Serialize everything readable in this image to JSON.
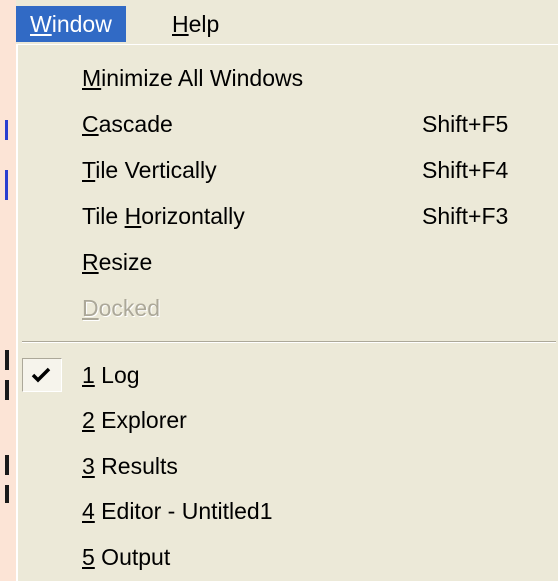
{
  "menubar": {
    "window": {
      "label_u": "W",
      "label_rest": "indow",
      "active": true
    },
    "help": {
      "label_u": "H",
      "label_rest": "elp"
    }
  },
  "menu": {
    "items": [
      {
        "u": "M",
        "rest": "inimize All Windows",
        "shortcut": "",
        "enabled": true
      },
      {
        "u": "C",
        "rest": "ascade",
        "shortcut": "Shift+F5",
        "enabled": true
      },
      {
        "u": "T",
        "rest": "ile Vertically",
        "shortcut": "Shift+F4",
        "enabled": true
      },
      {
        "pre": "Tile ",
        "u": "H",
        "rest": "orizontally",
        "shortcut": "Shift+F3",
        "enabled": true
      },
      {
        "u": "R",
        "rest": "esize",
        "shortcut": "",
        "enabled": true
      },
      {
        "u": "D",
        "rest": "ocked",
        "shortcut": "",
        "enabled": false
      }
    ],
    "windows": [
      {
        "u": "1",
        "rest": " Log",
        "checked": true
      },
      {
        "u": "2",
        "rest": " Explorer",
        "checked": false
      },
      {
        "u": "3",
        "rest": " Results",
        "checked": false
      },
      {
        "u": "4",
        "rest": " Editor - Untitled1",
        "checked": false
      },
      {
        "u": "5",
        "rest": " Output",
        "checked": false
      }
    ]
  },
  "colors": {
    "background": "#fce4d6",
    "menu_face": "#ece9d8",
    "highlight": "#316ac5",
    "disabled_text": "#aca899"
  },
  "icons": {
    "check": "checkmark-icon"
  }
}
